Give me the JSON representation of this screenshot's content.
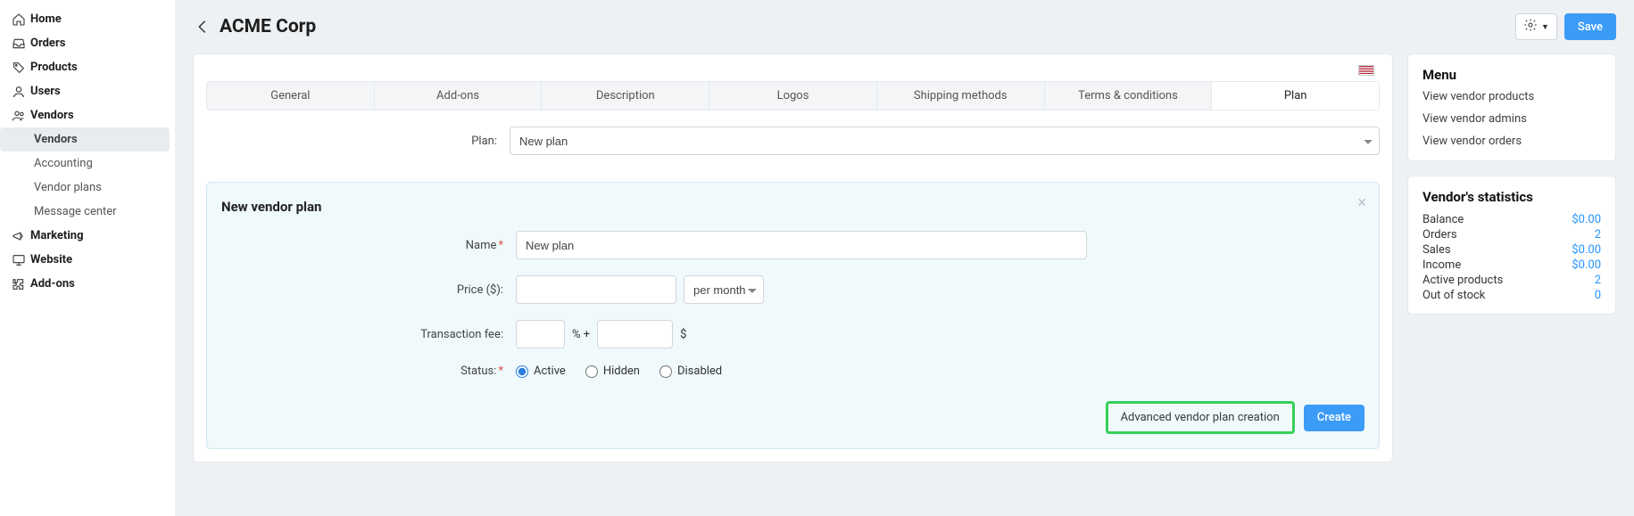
{
  "sidebar": {
    "items": [
      {
        "label": "Home"
      },
      {
        "label": "Orders"
      },
      {
        "label": "Products"
      },
      {
        "label": "Users"
      },
      {
        "label": "Vendors",
        "sub": [
          {
            "label": "Vendors",
            "active": true
          },
          {
            "label": "Accounting"
          },
          {
            "label": "Vendor plans"
          },
          {
            "label": "Message center"
          }
        ]
      },
      {
        "label": "Marketing"
      },
      {
        "label": "Website"
      },
      {
        "label": "Add-ons"
      }
    ]
  },
  "header": {
    "title": "ACME Corp",
    "save": "Save"
  },
  "tabs": [
    "General",
    "Add-ons",
    "Description",
    "Logos",
    "Shipping methods",
    "Terms & conditions",
    "Plan"
  ],
  "active_tab": "Plan",
  "plan_row": {
    "label": "Plan:",
    "value": "New plan"
  },
  "new_plan": {
    "title": "New vendor plan",
    "name_label": "Name",
    "name_value": "New plan",
    "price_label": "Price ($):",
    "price_value": "",
    "period_options": [
      "per month"
    ],
    "period_value": "per month",
    "txn_label": "Transaction fee:",
    "txn_pct": "",
    "txn_fixed": "",
    "status_label": "Status:",
    "status_options": [
      "Active",
      "Hidden",
      "Disabled"
    ],
    "status_value": "Active",
    "advanced": "Advanced vendor plan creation",
    "create": "Create"
  },
  "menu": {
    "title": "Menu",
    "links": [
      "View vendor products",
      "View vendor admins",
      "View vendor orders"
    ]
  },
  "stats": {
    "title": "Vendor's statistics",
    "rows": [
      {
        "k": "Balance",
        "v": "$0.00"
      },
      {
        "k": "Orders",
        "v": "2"
      },
      {
        "k": "Sales",
        "v": "$0.00"
      },
      {
        "k": "Income",
        "v": "$0.00"
      },
      {
        "k": "Active products",
        "v": "2"
      },
      {
        "k": "Out of stock",
        "v": "0"
      }
    ]
  }
}
